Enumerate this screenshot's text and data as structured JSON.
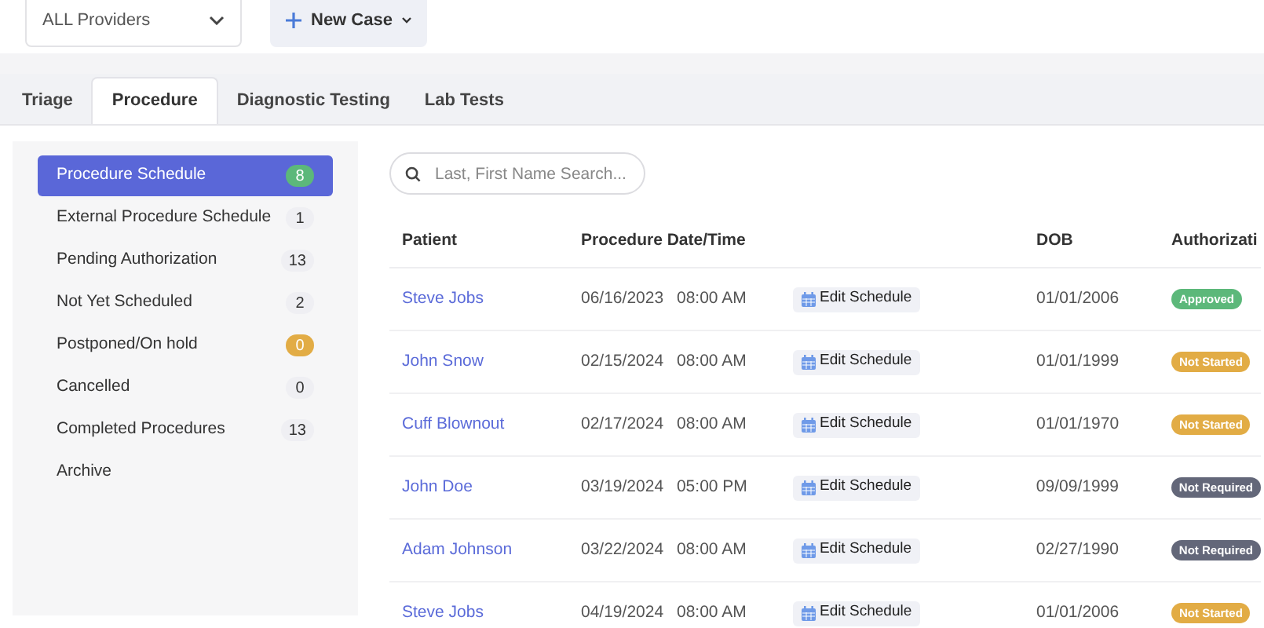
{
  "provider_select": {
    "value": "ALL Providers"
  },
  "new_case_button": {
    "label": "New Case"
  },
  "tabs": [
    {
      "label": "Triage",
      "selected": false
    },
    {
      "label": "Procedure",
      "selected": true
    },
    {
      "label": "Diagnostic Testing",
      "selected": false
    },
    {
      "label": "Lab Tests",
      "selected": false
    }
  ],
  "sidebar": {
    "items": [
      {
        "label": "Procedure Schedule",
        "count": "8",
        "color": "#5cb87a",
        "selected": true
      },
      {
        "label": "External Procedure Schedule",
        "count": "1",
        "color": "#efeff3",
        "selected": false
      },
      {
        "label": "Pending Authorization",
        "count": "13",
        "color": "#efeff3",
        "selected": false
      },
      {
        "label": "Not Yet Scheduled",
        "count": "2",
        "color": "#efeff3",
        "selected": false
      },
      {
        "label": "Postponed/On hold",
        "count": "0",
        "color": "#e2ac45",
        "selected": false
      },
      {
        "label": "Cancelled",
        "count": "0",
        "color": "#efeff3",
        "selected": false
      },
      {
        "label": "Completed Procedures",
        "count": "13",
        "color": "#efeff3",
        "selected": false
      },
      {
        "label": "Archive",
        "selected": false
      }
    ]
  },
  "search": {
    "placeholder": "Last, First Name Search..."
  },
  "table": {
    "columns": [
      "Patient",
      "Procedure Date/Time",
      "DOB",
      "Authorizati"
    ],
    "rows": [
      {
        "patient": "Steve Jobs",
        "date": "06/16/2023",
        "time": "08:00 AM",
        "action": "Edit Schedule",
        "dob": "01/01/2006",
        "authorization": "Approved",
        "color": "#5cb87a"
      },
      {
        "patient": "John Snow",
        "date": "02/15/2024",
        "time": "08:00 AM",
        "action": "Edit Schedule",
        "dob": "01/01/1999",
        "authorization": "Not Started",
        "color": "#e2ac45"
      },
      {
        "patient": "Cuff Blownout",
        "date": "02/17/2024",
        "time": "08:00 AM",
        "action": "Edit Schedule",
        "dob": "01/01/1970",
        "authorization": "Not Started",
        "color": "#e2ac45"
      },
      {
        "patient": "John Doe",
        "date": "03/19/2024",
        "time": "05:00 PM",
        "action": "Edit Schedule",
        "dob": "09/09/1999",
        "authorization": "Not Required",
        "color": "#636779"
      },
      {
        "patient": "Adam Johnson",
        "date": "03/22/2024",
        "time": "08:00 AM",
        "action": "Edit Schedule",
        "dob": "02/27/1990",
        "authorization": "Not Required",
        "color": "#636779"
      },
      {
        "patient": "Steve Jobs",
        "date": "04/19/2024",
        "time": "08:00 AM",
        "action": "Edit Schedule",
        "dob": "01/01/2006",
        "authorization": "Not Started",
        "color": "#e2ac45"
      }
    ]
  }
}
